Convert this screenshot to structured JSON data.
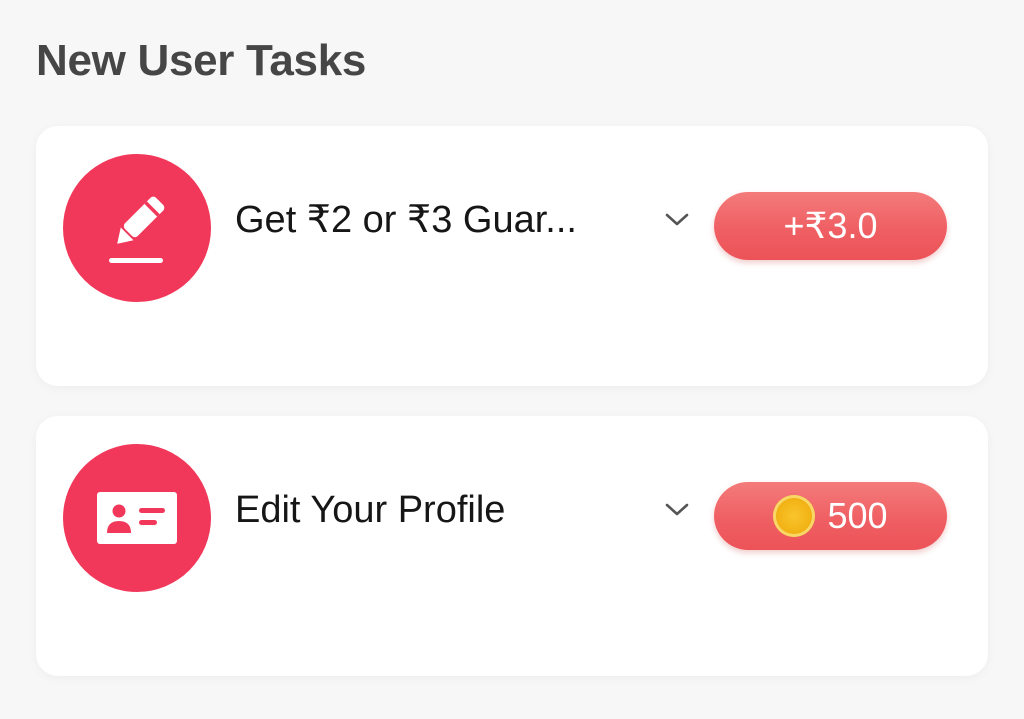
{
  "section": {
    "title": "New User Tasks"
  },
  "tasks": [
    {
      "label": "Get ₹2 or ₹3 Guar...",
      "icon": "pencil-icon",
      "reward": "+₹3.0"
    },
    {
      "label": "Edit Your Profile",
      "icon": "id-card-icon",
      "reward": "500",
      "reward_icon": "coin-icon"
    }
  ],
  "colors": {
    "accent": "#f2385a",
    "pill": "#ef5f63",
    "title": "#464646",
    "coin": "#f2b316"
  }
}
